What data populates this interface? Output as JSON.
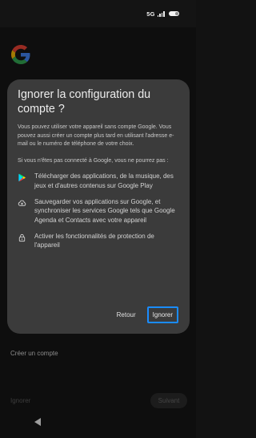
{
  "status_bar": {
    "network": "5G"
  },
  "background_page": {
    "logo": "google-g-logo",
    "create_account_label": "Créer un compte",
    "skip_label": "Ignorer",
    "next_label": "Suivant"
  },
  "dialog": {
    "title": "Ignorer la configuration du compte ?",
    "paragraph1": "Vous pouvez utiliser votre appareil sans compte Google. Vous pouvez aussi créer un compte plus tard en utilisant l'adresse e-mail ou le numéro de téléphone de votre choix.",
    "paragraph2": "Si vous n'êtes pas connecté à Google, vous ne pourrez pas :",
    "features": [
      {
        "icon": "google-play-icon",
        "text": "Télécharger des applications, de la musique, des jeux et d'autres contenus sur Google Play"
      },
      {
        "icon": "cloud-upload-icon",
        "text": "Sauvegarder vos applications sur Google, et synchroniser les services Google tels que Google Agenda et Contacts avec votre appareil"
      },
      {
        "icon": "lock-icon",
        "text": "Activer les fonctionnalités de protection de l'appareil"
      }
    ],
    "back_label": "Retour",
    "skip_label": "Ignorer"
  },
  "colors": {
    "dialog_bg": "#3b3b3b",
    "focus_ring": "#1a8cff",
    "screen_bg": "#161616"
  }
}
